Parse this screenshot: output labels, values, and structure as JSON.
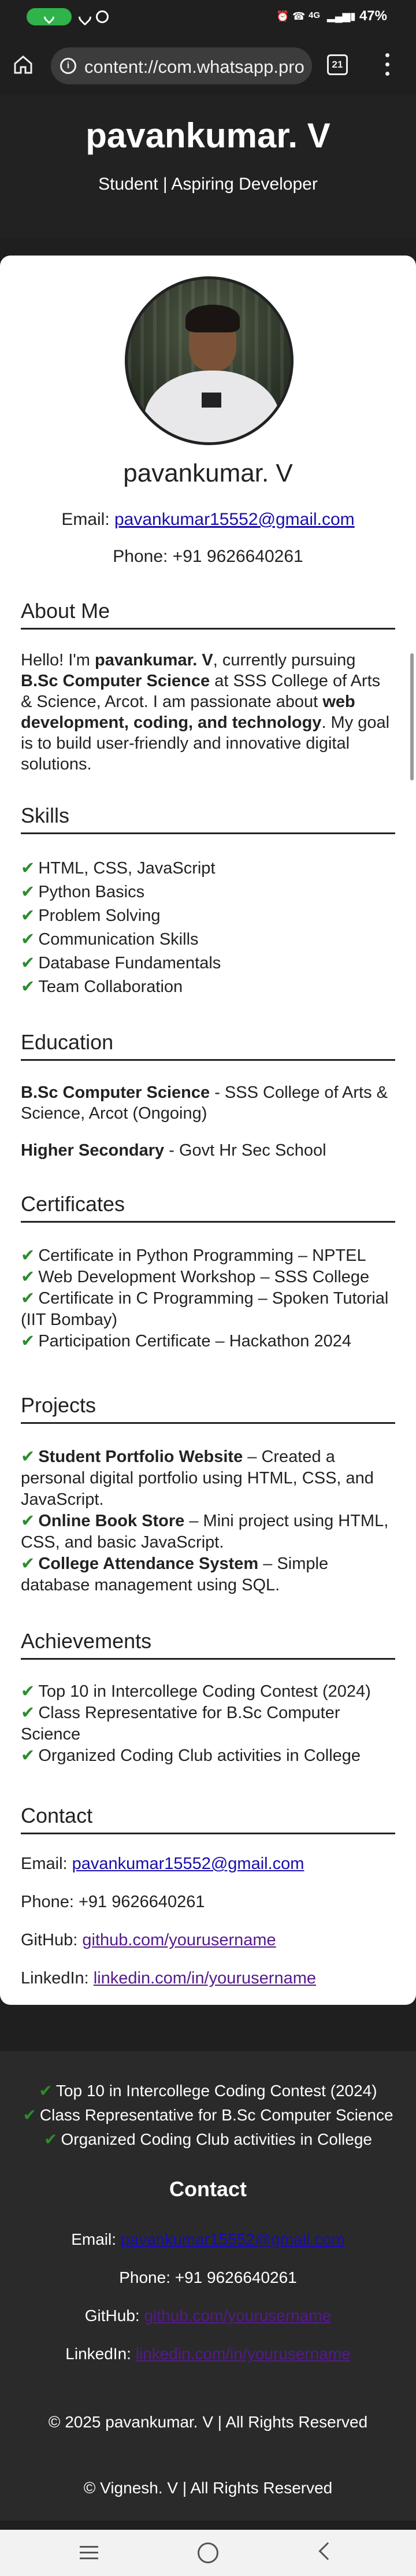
{
  "status_bar": {
    "battery": "47%",
    "network": "4G"
  },
  "browser": {
    "url": "content://com.whatsapp.provider.media/item/",
    "tab_count": "21"
  },
  "header": {
    "title": "pavankumar. V",
    "subtitle": "Student | Aspiring Developer"
  },
  "profile": {
    "name": "pavankumar. V",
    "email_label": "Email: ",
    "email": "pavankumar15552@gmail.com",
    "phone": "Phone: +91 9626640261"
  },
  "about": {
    "title": "About Me",
    "t1": "Hello! I'm ",
    "b1": "pavankumar. V",
    "t2": ", currently pursuing ",
    "b2": "B.Sc Computer Science",
    "t3": " at SSS College of Arts & Science, Arcot. I am passionate about ",
    "b3": "web development, coding, and technology",
    "t4": ". My goal is to build user-friendly and innovative digital solutions."
  },
  "skills": {
    "title": "Skills",
    "items": [
      "HTML, CSS, JavaScript",
      "Python Basics",
      "Problem Solving",
      "Communication Skills",
      "Database Fundamentals",
      "Team Collaboration"
    ]
  },
  "education": {
    "title": "Education",
    "e1_bold": "B.Sc Computer Science",
    "e1_text": " - SSS College of Arts & Science, Arcot (Ongoing)",
    "e2_bold": "Higher Secondary",
    "e2_text": " - Govt Hr Sec School"
  },
  "certificates": {
    "title": "Certificates",
    "items": [
      "Certificate in Python Programming – NPTEL",
      "Web Development Workshop – SSS College",
      "Certificate in C Programming – Spoken Tutorial (IIT Bombay)",
      "Participation Certificate – Hackathon 2024"
    ]
  },
  "projects": {
    "title": "Projects",
    "p1_bold": "Student Portfolio Website",
    "p1_text": " – Created a personal digital portfolio using HTML, CSS, and JavaScript.",
    "p2_bold": "Online Book Store",
    "p2_text": " – Mini project using HTML, CSS, and basic JavaScript.",
    "p3_bold": "College Attendance System",
    "p3_text": " – Simple database management using SQL."
  },
  "achievements": {
    "title": "Achievements",
    "items": [
      "Top 10 in Intercollege Coding Contest (2024)",
      "Class Representative for B.Sc Computer Science",
      "Organized Coding Club activities in College"
    ]
  },
  "contact": {
    "title": "Contact",
    "email_label": "Email: ",
    "email": "pavankumar15552@gmail.com",
    "phone": "Phone: +91 9626640261",
    "github_label": "GitHub: ",
    "github": "github.com/yourusername",
    "linkedin_label": "LinkedIn: ",
    "linkedin": "linkedin.com/in/yourusername"
  },
  "footer": {
    "achievements": [
      "Top 10 in Intercollege Coding Contest (2024)",
      "Class Representative for B.Sc Computer Science",
      "Organized Coding Club activities in College"
    ],
    "contact_title": "Contact",
    "email_label": "Email: ",
    "email": "pavankumar15552@gmail.com",
    "phone": "Phone: +91 9626640261",
    "github_label": "GitHub: ",
    "github": "github.com/yourusername",
    "linkedin_label": "LinkedIn: ",
    "linkedin": "linkedin.com/in/yourusername",
    "copyright": "© 2025 pavankumar. V | All Rights Reserved",
    "credit": "© Vignesh. V | All Rights Reserved"
  },
  "check_glyph": "✔",
  "colors": {
    "header_bg": "#222222",
    "link": "#1a0dab",
    "visited_link": "#551a8b",
    "check": "#2e8b2e"
  }
}
